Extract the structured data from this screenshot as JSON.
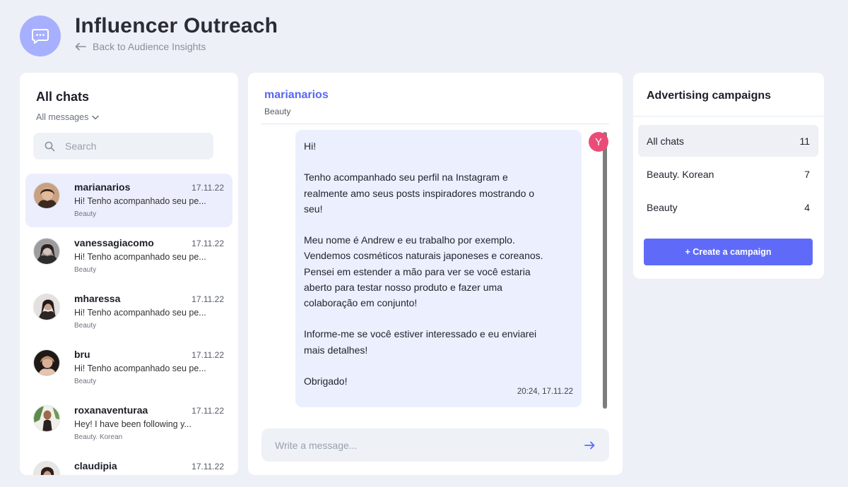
{
  "header": {
    "title": "Influencer Outreach",
    "back_label": "Back to Audience Insights"
  },
  "chats_panel": {
    "title": "All chats",
    "filter_label": "All messages",
    "search_placeholder": "Search",
    "items": [
      {
        "name": "marianarios",
        "date": "17.11.22",
        "preview": "Hi! Tenho acompanhado seu pe...",
        "tag": "Beauty"
      },
      {
        "name": "vanessagiacomo",
        "date": "17.11.22",
        "preview": "Hi! Tenho acompanhado seu pe...",
        "tag": "Beauty"
      },
      {
        "name": "mharessa",
        "date": "17.11.22",
        "preview": "Hi! Tenho acompanhado seu pe...",
        "tag": "Beauty"
      },
      {
        "name": "bru",
        "date": "17.11.22",
        "preview": "Hi! Tenho acompanhado seu pe...",
        "tag": "Beauty"
      },
      {
        "name": "roxanaventuraa",
        "date": "17.11.22",
        "preview": "Hey! I have been following y...",
        "tag": "Beauty. Korean"
      },
      {
        "name": "claudipia",
        "date": "17.11.22",
        "preview": "",
        "tag": ""
      }
    ]
  },
  "conversation": {
    "contact_name": "marianarios",
    "contact_tag": "Beauty",
    "sender_initial": "Y",
    "message": {
      "greeting": "Hi!",
      "line_1a": "Tenho acompanhado seu perfil na Instagram e",
      "line_1b": "realmente amo seus posts inspiradores mostrando o",
      "line_1c": "seu!",
      "line_2a": "Meu nome é Andrew e eu trabalho por exemplo.",
      "line_2b": "Vendemos cosméticos naturais japoneses e coreanos.",
      "line_2c": "Pensei em estender a mão para ver se você estaria",
      "line_2d": "aberto para testar nosso produto e fazer uma",
      "line_2e": "colaboração em conjunto!",
      "line_3a": "Informe-me se você estiver interessado e eu enviarei",
      "line_3b": "mais detalhes!",
      "closing": "Obrigado!",
      "time": "20:24, 17.11.22"
    },
    "composer_placeholder": "Write a message..."
  },
  "campaigns_panel": {
    "title": "Advertising campaigns",
    "items": [
      {
        "label": "All chats",
        "count": "11"
      },
      {
        "label": "Beauty. Korean",
        "count": "7"
      },
      {
        "label": "Beauty",
        "count": "4"
      }
    ],
    "create_label": "+ Create a campaign"
  },
  "colors": {
    "accent": "#5f6bf8",
    "contact_name": "#5866f0",
    "app_icon_bg": "#a7b0ff",
    "sender_badge": "#ea4c77",
    "bubble_bg": "#eceffd"
  }
}
